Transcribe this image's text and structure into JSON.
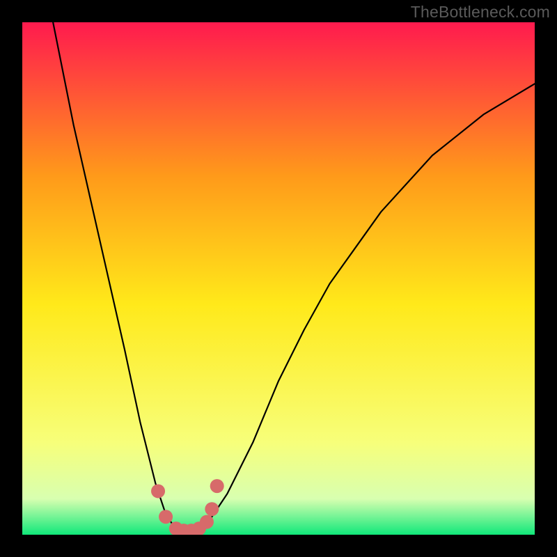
{
  "watermark": "TheBottleneck.com",
  "chart_data": {
    "type": "line",
    "title": "",
    "xlabel": "",
    "ylabel": "",
    "xlim": [
      0,
      100
    ],
    "ylim": [
      0,
      100
    ],
    "grid": false,
    "legend": false,
    "background_gradient": {
      "top": "#ff1a4e",
      "mid_upper": "#ff9a1a",
      "mid": "#ffe91a",
      "lower": "#f7ff7a",
      "bottom": "#10e87a"
    },
    "series": [
      {
        "name": "bottleneck-curve",
        "x": [
          6,
          10,
          15,
          20,
          23,
          26,
          28,
          30,
          32,
          34,
          36,
          40,
          45,
          50,
          55,
          60,
          70,
          80,
          90,
          100
        ],
        "y": [
          100,
          80,
          58,
          36,
          22,
          10,
          4,
          1,
          0,
          0,
          2,
          8,
          18,
          30,
          40,
          49,
          63,
          74,
          82,
          88
        ]
      }
    ],
    "markers": {
      "name": "highlight-points",
      "color": "#d76a6a",
      "x": [
        26.5,
        28.0,
        30.0,
        31.5,
        33.0,
        34.5,
        36.0,
        37.0,
        38.0
      ],
      "y": [
        8.5,
        3.5,
        1.2,
        0.8,
        0.8,
        1.2,
        2.5,
        5.0,
        9.5
      ]
    }
  }
}
